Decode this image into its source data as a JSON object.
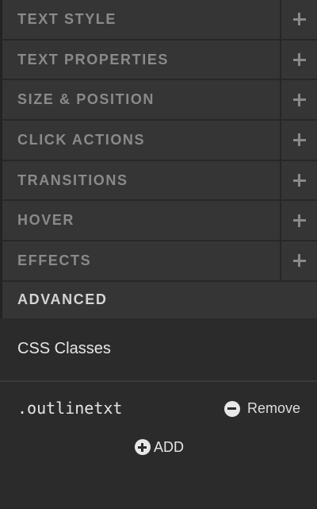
{
  "sections": [
    {
      "label": "TEXT STYLE",
      "toggle_icon": "plus-icon"
    },
    {
      "label": "TEXT PROPERTIES",
      "toggle_icon": "plus-icon"
    },
    {
      "label": "SIZE & POSITION",
      "toggle_icon": "plus-icon"
    },
    {
      "label": "CLICK ACTIONS",
      "toggle_icon": "plus-icon"
    },
    {
      "label": "TRANSITIONS",
      "toggle_icon": "plus-icon"
    },
    {
      "label": "HOVER",
      "toggle_icon": "plus-icon"
    },
    {
      "label": "EFFECTS",
      "toggle_icon": "plus-icon"
    }
  ],
  "advanced": {
    "label": "ADVANCED",
    "css_classes_title": "CSS Classes",
    "classes": [
      {
        "name": ".outlinetxt",
        "remove_label": "Remove",
        "remove_icon": "minus-circle-icon"
      }
    ],
    "add_label": "ADD",
    "add_icon": "plus-circle-icon"
  },
  "colors": {
    "panel_background": "#2b2b2b",
    "row_background": "#353535",
    "collapsed_label": "#8a8a8a",
    "active_label": "#d4d4d4",
    "text": "#e6e6e6"
  }
}
